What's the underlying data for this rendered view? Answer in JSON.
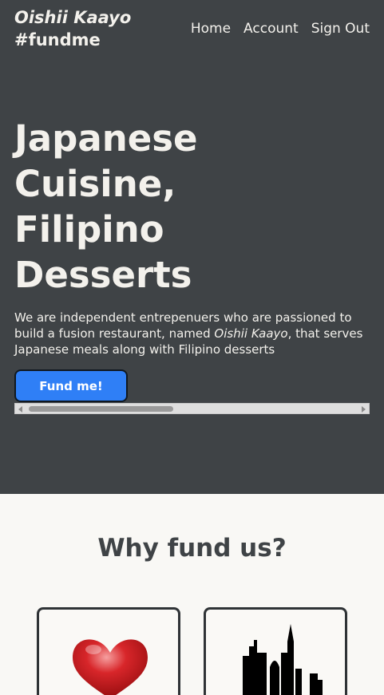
{
  "brand": {
    "name": "Oishii Kaayo",
    "tag": "#fundme"
  },
  "nav": {
    "items": [
      "Home",
      "Account",
      "Sign Out"
    ]
  },
  "hero": {
    "headline": "Japanese Cuisine, Filipino Desserts",
    "desc_before": "We are independent entrepenuers who are passioned to build a fusion restaurant, named ",
    "desc_name": "Oishii Kaayo",
    "desc_after": ", that serves Japanese meals along with Filipino desserts",
    "cta": "Fund me!"
  },
  "why": {
    "title": "Why fund us?"
  },
  "cards": [
    {
      "icon": "heart-icon"
    },
    {
      "icon": "skyline-icon"
    }
  ],
  "colors": {
    "hero_bg": "#3f4346",
    "button": "#2f7ff6",
    "page_bg": "#f9f8f5"
  }
}
